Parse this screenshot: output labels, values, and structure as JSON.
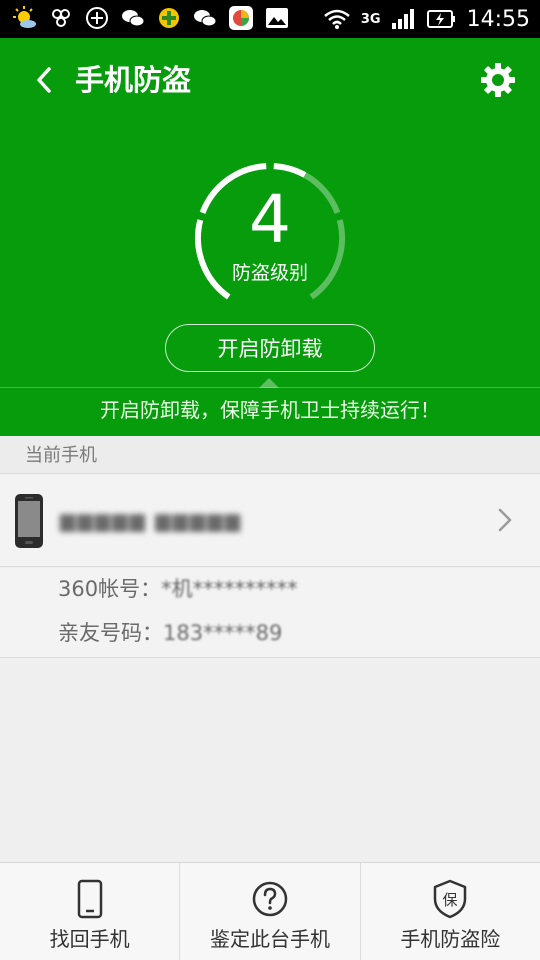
{
  "status_bar": {
    "network": "3G",
    "time": "14:55",
    "icons": [
      "weather-icon",
      "apps-icon",
      "add-circle-icon",
      "wechat-icon",
      "game-icon",
      "wechat-icon",
      "app-store-icon",
      "gallery-icon"
    ]
  },
  "header": {
    "title": "手机防盗",
    "level_value": "4",
    "level_label": "防盗级别",
    "level_progress": 0.6,
    "enable_button": "开启防卸载",
    "tip": "开启防卸载，保障手机卫士持续运行！"
  },
  "current_phone": {
    "section_title": "当前手机",
    "device_name": "▆▆▆▆▆ ▆▆▆▆▆",
    "account_label": "360帐号：",
    "account_value": "*机**********",
    "family_label": "亲友号码：",
    "family_value": "183*****89"
  },
  "bottom_nav": {
    "items": [
      {
        "label": "找回手机",
        "icon": "phone-icon"
      },
      {
        "label": "鉴定此台手机",
        "icon": "question-icon"
      },
      {
        "label": "手机防盗险",
        "icon": "insurance-shield-icon"
      }
    ]
  },
  "colors": {
    "brand_green": "#069c0b",
    "text_gray": "#6a6a6a"
  }
}
